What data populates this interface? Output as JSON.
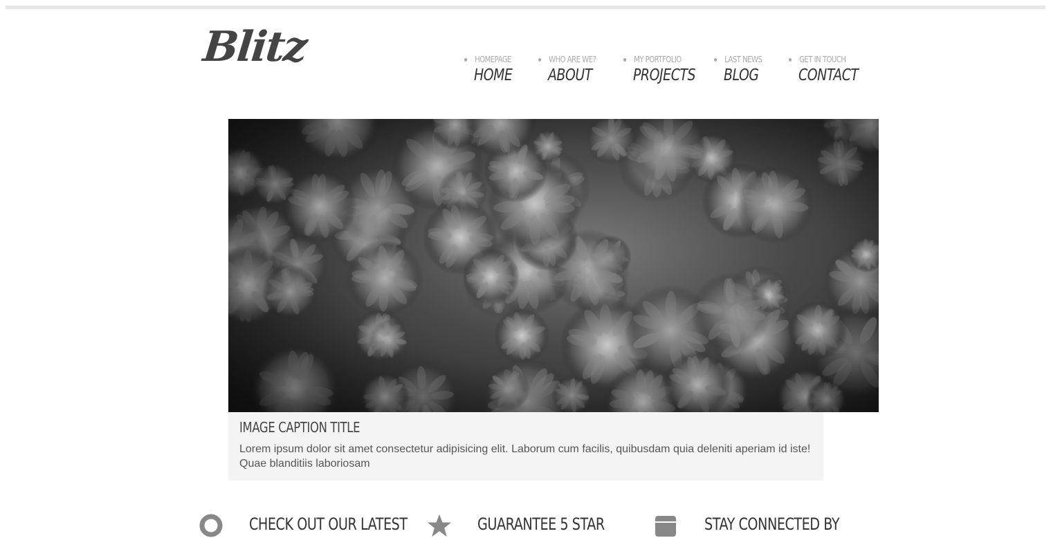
{
  "site": {
    "logo_text": "Blitz"
  },
  "nav": {
    "items": [
      {
        "sub": "Homepage",
        "label": "Home"
      },
      {
        "sub": "Who are we?",
        "label": "About"
      },
      {
        "sub": "My portfolio",
        "label": "Projects"
      },
      {
        "sub": "Last news",
        "label": "Blog"
      },
      {
        "sub": "Get in touch",
        "label": "Contact"
      }
    ]
  },
  "hero": {
    "caption_title": "Image Caption Title",
    "caption_text": "Lorem ipsum dolor sit amet consectetur adipisicing elit. Laborum cum facilis, quibusdam quia deleniti aperiam id iste! Quae blanditiis laboriosam"
  },
  "features": [
    {
      "icon": "map-pin-icon",
      "title": "Check out our latest"
    },
    {
      "icon": "star-icon",
      "title": "Guarantee 5 star"
    },
    {
      "icon": "calendar-icon",
      "title": "Stay connected by"
    }
  ],
  "colors": {
    "text_dark": "#333333",
    "text_muted": "#aaaaaa",
    "caption_bg": "#f4f4f4",
    "top_rule": "#e8e8e8"
  }
}
